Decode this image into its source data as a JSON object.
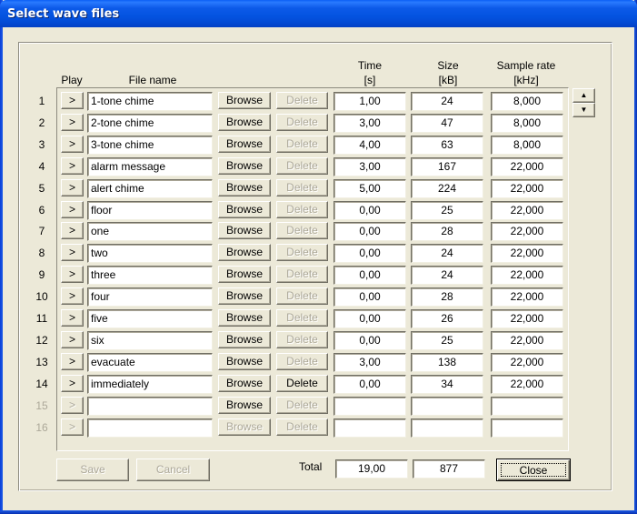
{
  "window": {
    "title": "Select wave files"
  },
  "headers": {
    "play": "Play",
    "file_name": "File name",
    "time_line1": "Time",
    "time_line2": "[s]",
    "size_line1": "Size",
    "size_line2": "[kB]",
    "rate_line1": "Sample rate",
    "rate_line2": "[kHz]"
  },
  "buttons": {
    "play": ">",
    "browse": "Browse",
    "delete": "Delete",
    "save": "Save",
    "cancel": "Cancel",
    "close": "Close",
    "scroll_up": "▲",
    "scroll_down": "▼"
  },
  "rows": [
    {
      "num": "1",
      "name": "1-tone chime",
      "time": "1,00",
      "size": "24",
      "rate": "8,000",
      "play_enabled": true,
      "browse_enabled": true,
      "delete_enabled": false
    },
    {
      "num": "2",
      "name": "2-tone chime",
      "time": "3,00",
      "size": "47",
      "rate": "8,000",
      "play_enabled": true,
      "browse_enabled": true,
      "delete_enabled": false
    },
    {
      "num": "3",
      "name": "3-tone chime",
      "time": "4,00",
      "size": "63",
      "rate": "8,000",
      "play_enabled": true,
      "browse_enabled": true,
      "delete_enabled": false
    },
    {
      "num": "4",
      "name": "alarm message",
      "time": "3,00",
      "size": "167",
      "rate": "22,000",
      "play_enabled": true,
      "browse_enabled": true,
      "delete_enabled": false
    },
    {
      "num": "5",
      "name": "alert chime",
      "time": "5,00",
      "size": "224",
      "rate": "22,000",
      "play_enabled": true,
      "browse_enabled": true,
      "delete_enabled": false
    },
    {
      "num": "6",
      "name": "floor",
      "time": "0,00",
      "size": "25",
      "rate": "22,000",
      "play_enabled": true,
      "browse_enabled": true,
      "delete_enabled": false
    },
    {
      "num": "7",
      "name": "one",
      "time": "0,00",
      "size": "28",
      "rate": "22,000",
      "play_enabled": true,
      "browse_enabled": true,
      "delete_enabled": false
    },
    {
      "num": "8",
      "name": "two",
      "time": "0,00",
      "size": "24",
      "rate": "22,000",
      "play_enabled": true,
      "browse_enabled": true,
      "delete_enabled": false
    },
    {
      "num": "9",
      "name": "three",
      "time": "0,00",
      "size": "24",
      "rate": "22,000",
      "play_enabled": true,
      "browse_enabled": true,
      "delete_enabled": false
    },
    {
      "num": "10",
      "name": "four",
      "time": "0,00",
      "size": "28",
      "rate": "22,000",
      "play_enabled": true,
      "browse_enabled": true,
      "delete_enabled": false
    },
    {
      "num": "11",
      "name": "five",
      "time": "0,00",
      "size": "26",
      "rate": "22,000",
      "play_enabled": true,
      "browse_enabled": true,
      "delete_enabled": false
    },
    {
      "num": "12",
      "name": "six",
      "time": "0,00",
      "size": "25",
      "rate": "22,000",
      "play_enabled": true,
      "browse_enabled": true,
      "delete_enabled": false
    },
    {
      "num": "13",
      "name": "evacuate",
      "time": "3,00",
      "size": "138",
      "rate": "22,000",
      "play_enabled": true,
      "browse_enabled": true,
      "delete_enabled": false
    },
    {
      "num": "14",
      "name": "immediately",
      "time": "0,00",
      "size": "34",
      "rate": "22,000",
      "play_enabled": true,
      "browse_enabled": true,
      "delete_enabled": true
    },
    {
      "num": "15",
      "name": "",
      "time": "",
      "size": "",
      "rate": "",
      "play_enabled": false,
      "browse_enabled": true,
      "delete_enabled": false
    },
    {
      "num": "16",
      "name": "",
      "time": "",
      "size": "",
      "rate": "",
      "play_enabled": false,
      "browse_enabled": false,
      "delete_enabled": false
    }
  ],
  "footer": {
    "total_label": "Total",
    "total_time": "19,00",
    "total_size": "877",
    "save_enabled": false,
    "cancel_enabled": false
  }
}
